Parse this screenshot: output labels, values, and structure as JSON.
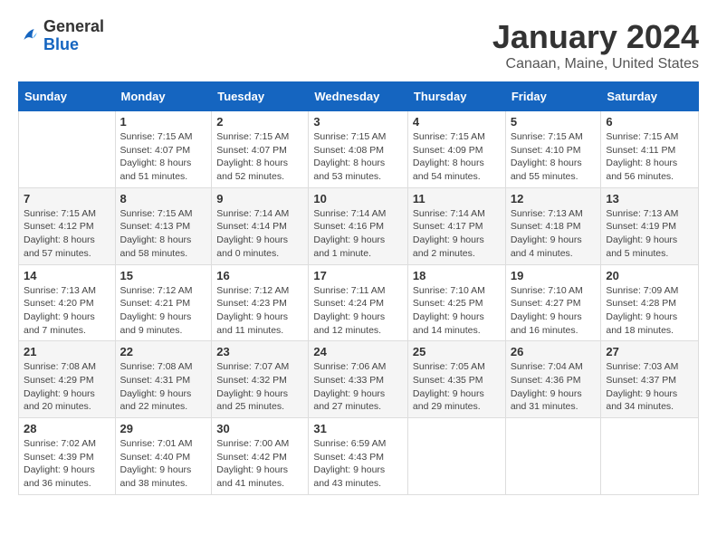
{
  "header": {
    "logo_general": "General",
    "logo_blue": "Blue",
    "title": "January 2024",
    "subtitle": "Canaan, Maine, United States"
  },
  "weekdays": [
    "Sunday",
    "Monday",
    "Tuesday",
    "Wednesday",
    "Thursday",
    "Friday",
    "Saturday"
  ],
  "weeks": [
    [
      {
        "day": "",
        "sunrise": "",
        "sunset": "",
        "daylight": ""
      },
      {
        "day": "1",
        "sunrise": "Sunrise: 7:15 AM",
        "sunset": "Sunset: 4:07 PM",
        "daylight": "Daylight: 8 hours and 51 minutes."
      },
      {
        "day": "2",
        "sunrise": "Sunrise: 7:15 AM",
        "sunset": "Sunset: 4:07 PM",
        "daylight": "Daylight: 8 hours and 52 minutes."
      },
      {
        "day": "3",
        "sunrise": "Sunrise: 7:15 AM",
        "sunset": "Sunset: 4:08 PM",
        "daylight": "Daylight: 8 hours and 53 minutes."
      },
      {
        "day": "4",
        "sunrise": "Sunrise: 7:15 AM",
        "sunset": "Sunset: 4:09 PM",
        "daylight": "Daylight: 8 hours and 54 minutes."
      },
      {
        "day": "5",
        "sunrise": "Sunrise: 7:15 AM",
        "sunset": "Sunset: 4:10 PM",
        "daylight": "Daylight: 8 hours and 55 minutes."
      },
      {
        "day": "6",
        "sunrise": "Sunrise: 7:15 AM",
        "sunset": "Sunset: 4:11 PM",
        "daylight": "Daylight: 8 hours and 56 minutes."
      }
    ],
    [
      {
        "day": "7",
        "sunrise": "Sunrise: 7:15 AM",
        "sunset": "Sunset: 4:12 PM",
        "daylight": "Daylight: 8 hours and 57 minutes."
      },
      {
        "day": "8",
        "sunrise": "Sunrise: 7:15 AM",
        "sunset": "Sunset: 4:13 PM",
        "daylight": "Daylight: 8 hours and 58 minutes."
      },
      {
        "day": "9",
        "sunrise": "Sunrise: 7:14 AM",
        "sunset": "Sunset: 4:14 PM",
        "daylight": "Daylight: 9 hours and 0 minutes."
      },
      {
        "day": "10",
        "sunrise": "Sunrise: 7:14 AM",
        "sunset": "Sunset: 4:16 PM",
        "daylight": "Daylight: 9 hours and 1 minute."
      },
      {
        "day": "11",
        "sunrise": "Sunrise: 7:14 AM",
        "sunset": "Sunset: 4:17 PM",
        "daylight": "Daylight: 9 hours and 2 minutes."
      },
      {
        "day": "12",
        "sunrise": "Sunrise: 7:13 AM",
        "sunset": "Sunset: 4:18 PM",
        "daylight": "Daylight: 9 hours and 4 minutes."
      },
      {
        "day": "13",
        "sunrise": "Sunrise: 7:13 AM",
        "sunset": "Sunset: 4:19 PM",
        "daylight": "Daylight: 9 hours and 5 minutes."
      }
    ],
    [
      {
        "day": "14",
        "sunrise": "Sunrise: 7:13 AM",
        "sunset": "Sunset: 4:20 PM",
        "daylight": "Daylight: 9 hours and 7 minutes."
      },
      {
        "day": "15",
        "sunrise": "Sunrise: 7:12 AM",
        "sunset": "Sunset: 4:21 PM",
        "daylight": "Daylight: 9 hours and 9 minutes."
      },
      {
        "day": "16",
        "sunrise": "Sunrise: 7:12 AM",
        "sunset": "Sunset: 4:23 PM",
        "daylight": "Daylight: 9 hours and 11 minutes."
      },
      {
        "day": "17",
        "sunrise": "Sunrise: 7:11 AM",
        "sunset": "Sunset: 4:24 PM",
        "daylight": "Daylight: 9 hours and 12 minutes."
      },
      {
        "day": "18",
        "sunrise": "Sunrise: 7:10 AM",
        "sunset": "Sunset: 4:25 PM",
        "daylight": "Daylight: 9 hours and 14 minutes."
      },
      {
        "day": "19",
        "sunrise": "Sunrise: 7:10 AM",
        "sunset": "Sunset: 4:27 PM",
        "daylight": "Daylight: 9 hours and 16 minutes."
      },
      {
        "day": "20",
        "sunrise": "Sunrise: 7:09 AM",
        "sunset": "Sunset: 4:28 PM",
        "daylight": "Daylight: 9 hours and 18 minutes."
      }
    ],
    [
      {
        "day": "21",
        "sunrise": "Sunrise: 7:08 AM",
        "sunset": "Sunset: 4:29 PM",
        "daylight": "Daylight: 9 hours and 20 minutes."
      },
      {
        "day": "22",
        "sunrise": "Sunrise: 7:08 AM",
        "sunset": "Sunset: 4:31 PM",
        "daylight": "Daylight: 9 hours and 22 minutes."
      },
      {
        "day": "23",
        "sunrise": "Sunrise: 7:07 AM",
        "sunset": "Sunset: 4:32 PM",
        "daylight": "Daylight: 9 hours and 25 minutes."
      },
      {
        "day": "24",
        "sunrise": "Sunrise: 7:06 AM",
        "sunset": "Sunset: 4:33 PM",
        "daylight": "Daylight: 9 hours and 27 minutes."
      },
      {
        "day": "25",
        "sunrise": "Sunrise: 7:05 AM",
        "sunset": "Sunset: 4:35 PM",
        "daylight": "Daylight: 9 hours and 29 minutes."
      },
      {
        "day": "26",
        "sunrise": "Sunrise: 7:04 AM",
        "sunset": "Sunset: 4:36 PM",
        "daylight": "Daylight: 9 hours and 31 minutes."
      },
      {
        "day": "27",
        "sunrise": "Sunrise: 7:03 AM",
        "sunset": "Sunset: 4:37 PM",
        "daylight": "Daylight: 9 hours and 34 minutes."
      }
    ],
    [
      {
        "day": "28",
        "sunrise": "Sunrise: 7:02 AM",
        "sunset": "Sunset: 4:39 PM",
        "daylight": "Daylight: 9 hours and 36 minutes."
      },
      {
        "day": "29",
        "sunrise": "Sunrise: 7:01 AM",
        "sunset": "Sunset: 4:40 PM",
        "daylight": "Daylight: 9 hours and 38 minutes."
      },
      {
        "day": "30",
        "sunrise": "Sunrise: 7:00 AM",
        "sunset": "Sunset: 4:42 PM",
        "daylight": "Daylight: 9 hours and 41 minutes."
      },
      {
        "day": "31",
        "sunrise": "Sunrise: 6:59 AM",
        "sunset": "Sunset: 4:43 PM",
        "daylight": "Daylight: 9 hours and 43 minutes."
      },
      {
        "day": "",
        "sunrise": "",
        "sunset": "",
        "daylight": ""
      },
      {
        "day": "",
        "sunrise": "",
        "sunset": "",
        "daylight": ""
      },
      {
        "day": "",
        "sunrise": "",
        "sunset": "",
        "daylight": ""
      }
    ]
  ]
}
